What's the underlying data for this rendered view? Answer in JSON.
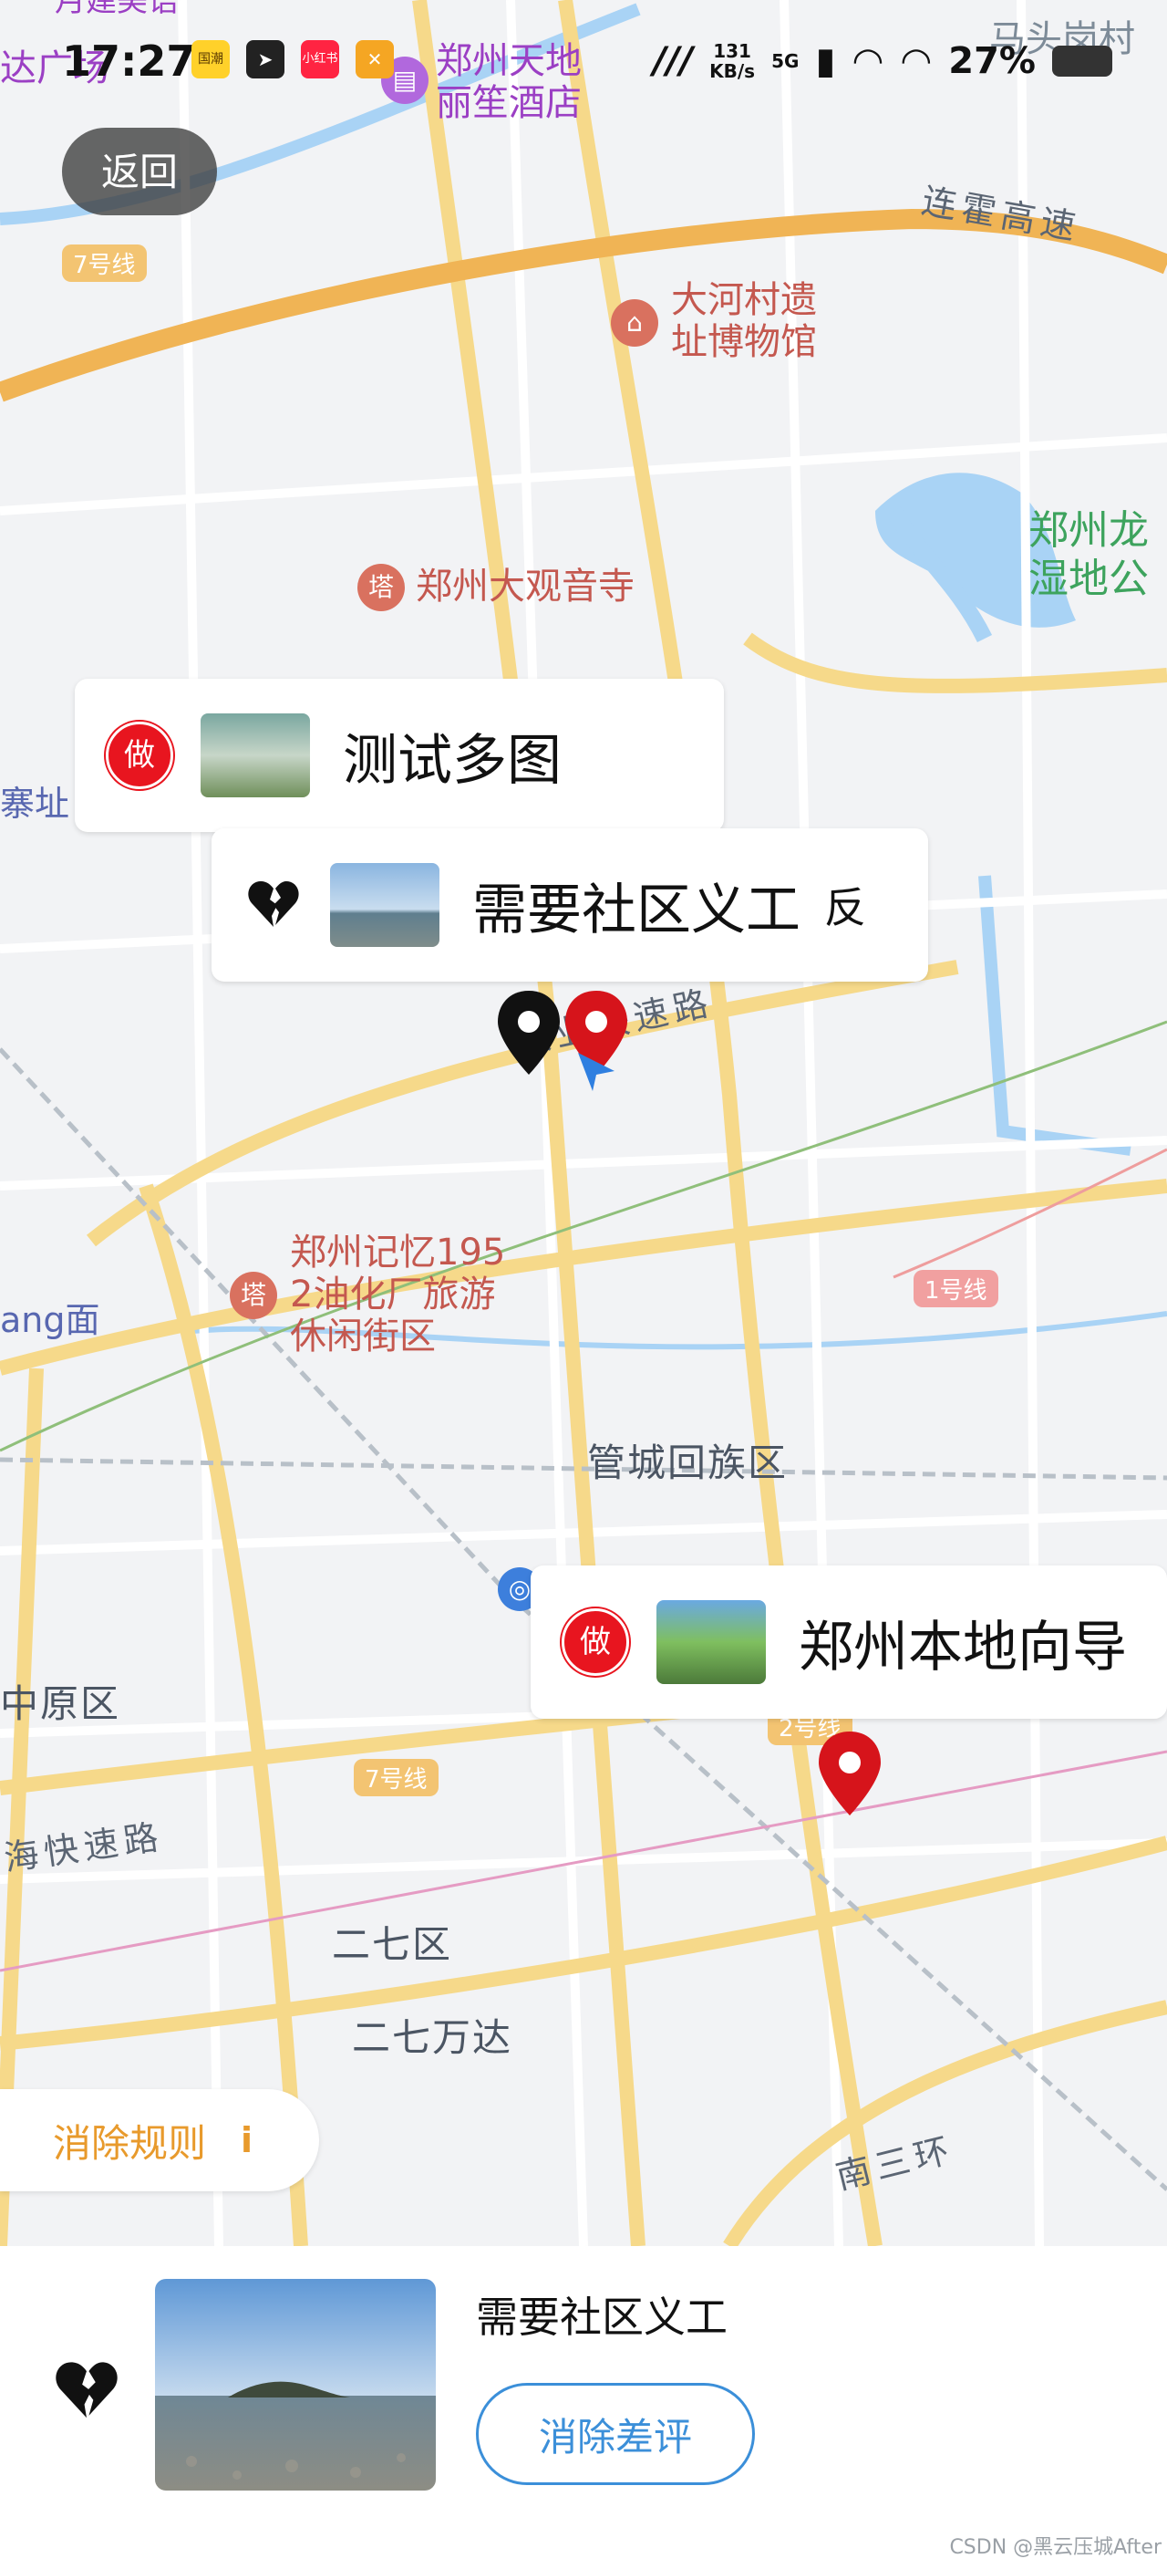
{
  "status_bar": {
    "time": "17:27",
    "network_speed_value": "131",
    "network_speed_unit": "KB/s",
    "signal_label": "5G",
    "battery": "27%",
    "app_icons": [
      "meituan-app-icon",
      "telegram-app-icon",
      "xiaohongshu-app-icon",
      "tools-app-icon"
    ],
    "xiaohongshu_label": "小红书",
    "meituan_label": "国潮"
  },
  "back_button": {
    "label": "返回"
  },
  "map": {
    "labels": {
      "top_partial": "月建美语",
      "top_left_partial": "达广场",
      "hotel": "郑州天地丽笙酒店",
      "hotel_line1": "郑州天地",
      "hotel_line2": "丽笙酒店",
      "village": "马头岗村",
      "expressway": "连霍高速",
      "museum_line1": "大河村遗",
      "museum_line2": "址博物馆",
      "wetland_line1": "郑州龙",
      "wetland_line2": "湿地公",
      "temple": "郑州大观音寺",
      "left_partial_1": "寨址",
      "farm_road": "农业快速路",
      "memory_line1": "郑州记忆195",
      "memory_line2": "2油化厂旅游",
      "memory_line3": "休闲街区",
      "left_partial_2": "ang面",
      "guancheng": "管城回族区",
      "zhongyuan": "中原区",
      "hai_road": "海快速路",
      "erqi_district": "二七区",
      "erqi_wanda": "二七万达",
      "nan_san_huan": "南三环"
    },
    "metro": {
      "line7_top": "7号线",
      "line7_bottom": "7号线",
      "line1": "1号线",
      "line2": "2号线"
    }
  },
  "callouts": [
    {
      "badge": "做",
      "title": "测试多图"
    },
    {
      "badge_icon": "broken-heart-icon",
      "title": "需要社区义工",
      "trailing": "反"
    },
    {
      "badge": "做",
      "title": "郑州本地向导"
    }
  ],
  "rule_button": {
    "label": "消除规则",
    "info": "i"
  },
  "bottom_card": {
    "title": "需要社区义工",
    "action_label": "消除差评"
  },
  "watermark": "CSDN @黑云压城After",
  "colors": {
    "badge_red": "#e8151f",
    "accent_blue": "#3b8fd9",
    "rule_orange": "#e89a2c",
    "road_yellow": "#f6d98a",
    "expressway_orange": "#f0b455",
    "water_blue": "#a9d3f5"
  }
}
